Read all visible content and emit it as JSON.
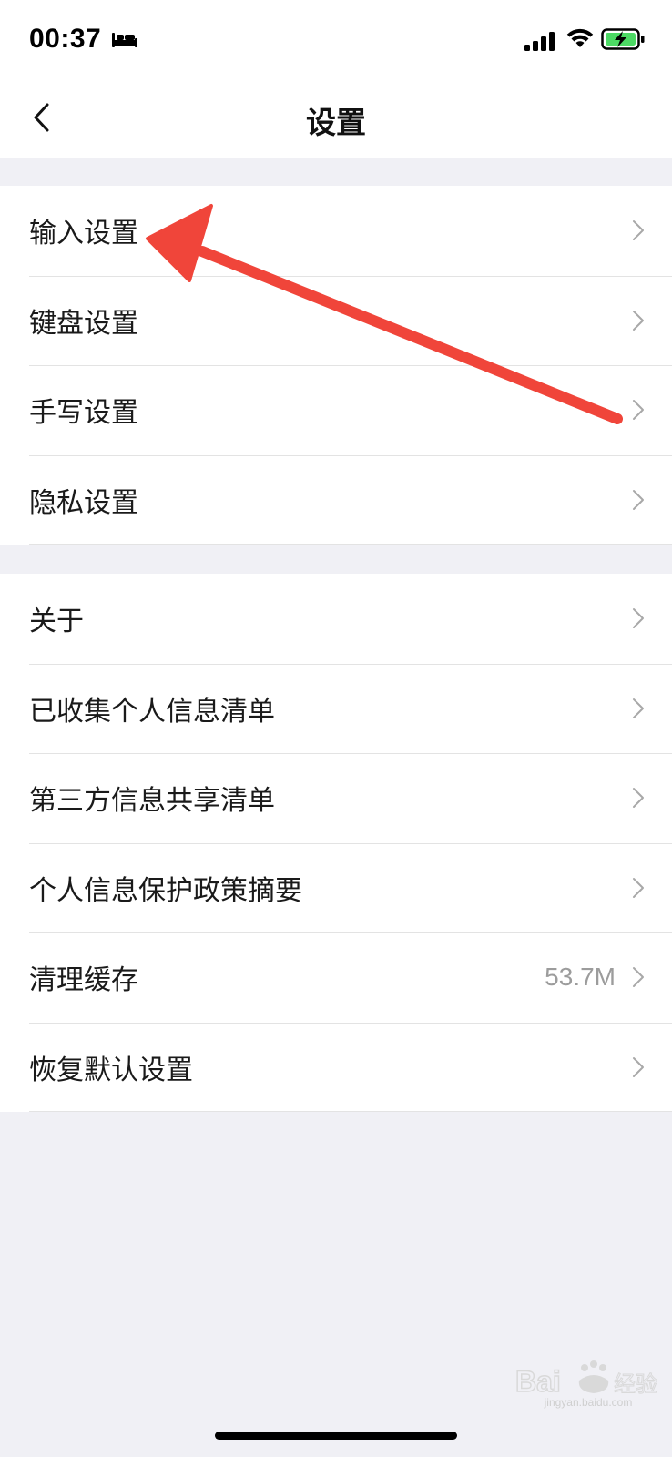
{
  "status_bar": {
    "time": "00:37",
    "icons": [
      "sleep-icon",
      "signal-icon",
      "wifi-icon",
      "battery-charging-icon"
    ]
  },
  "nav": {
    "title": "设置",
    "back_icon": "chevron-left-icon"
  },
  "group1": {
    "items": [
      {
        "label": "输入设置"
      },
      {
        "label": "键盘设置"
      },
      {
        "label": "手写设置"
      },
      {
        "label": "隐私设置"
      }
    ]
  },
  "group2": {
    "items": [
      {
        "label": "关于"
      },
      {
        "label": "已收集个人信息清单"
      },
      {
        "label": "第三方信息共享清单"
      },
      {
        "label": "个人信息保护政策摘要"
      },
      {
        "label": "清理缓存",
        "value": "53.7M"
      },
      {
        "label": "恢复默认设置"
      }
    ]
  },
  "annotation": {
    "color": "#f0453a",
    "icon": "red-arrow"
  },
  "watermark": {
    "logo": "Bai 经验",
    "url": "jingyan.baidu.com"
  }
}
